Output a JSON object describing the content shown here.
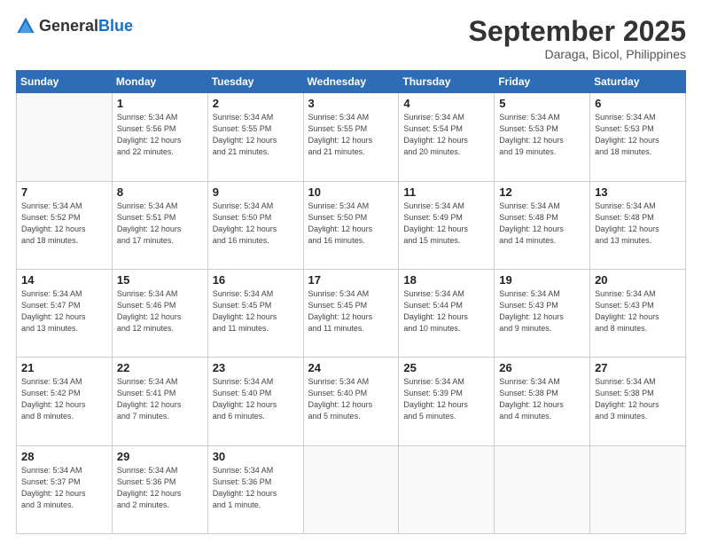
{
  "header": {
    "logo_general": "General",
    "logo_blue": "Blue",
    "month_title": "September 2025",
    "location": "Daraga, Bicol, Philippines"
  },
  "weekdays": [
    "Sunday",
    "Monday",
    "Tuesday",
    "Wednesday",
    "Thursday",
    "Friday",
    "Saturday"
  ],
  "weeks": [
    [
      {
        "day": "",
        "info": ""
      },
      {
        "day": "1",
        "info": "Sunrise: 5:34 AM\nSunset: 5:56 PM\nDaylight: 12 hours\nand 22 minutes."
      },
      {
        "day": "2",
        "info": "Sunrise: 5:34 AM\nSunset: 5:55 PM\nDaylight: 12 hours\nand 21 minutes."
      },
      {
        "day": "3",
        "info": "Sunrise: 5:34 AM\nSunset: 5:55 PM\nDaylight: 12 hours\nand 21 minutes."
      },
      {
        "day": "4",
        "info": "Sunrise: 5:34 AM\nSunset: 5:54 PM\nDaylight: 12 hours\nand 20 minutes."
      },
      {
        "day": "5",
        "info": "Sunrise: 5:34 AM\nSunset: 5:53 PM\nDaylight: 12 hours\nand 19 minutes."
      },
      {
        "day": "6",
        "info": "Sunrise: 5:34 AM\nSunset: 5:53 PM\nDaylight: 12 hours\nand 18 minutes."
      }
    ],
    [
      {
        "day": "7",
        "info": "Sunrise: 5:34 AM\nSunset: 5:52 PM\nDaylight: 12 hours\nand 18 minutes."
      },
      {
        "day": "8",
        "info": "Sunrise: 5:34 AM\nSunset: 5:51 PM\nDaylight: 12 hours\nand 17 minutes."
      },
      {
        "day": "9",
        "info": "Sunrise: 5:34 AM\nSunset: 5:50 PM\nDaylight: 12 hours\nand 16 minutes."
      },
      {
        "day": "10",
        "info": "Sunrise: 5:34 AM\nSunset: 5:50 PM\nDaylight: 12 hours\nand 16 minutes."
      },
      {
        "day": "11",
        "info": "Sunrise: 5:34 AM\nSunset: 5:49 PM\nDaylight: 12 hours\nand 15 minutes."
      },
      {
        "day": "12",
        "info": "Sunrise: 5:34 AM\nSunset: 5:48 PM\nDaylight: 12 hours\nand 14 minutes."
      },
      {
        "day": "13",
        "info": "Sunrise: 5:34 AM\nSunset: 5:48 PM\nDaylight: 12 hours\nand 13 minutes."
      }
    ],
    [
      {
        "day": "14",
        "info": "Sunrise: 5:34 AM\nSunset: 5:47 PM\nDaylight: 12 hours\nand 13 minutes."
      },
      {
        "day": "15",
        "info": "Sunrise: 5:34 AM\nSunset: 5:46 PM\nDaylight: 12 hours\nand 12 minutes."
      },
      {
        "day": "16",
        "info": "Sunrise: 5:34 AM\nSunset: 5:45 PM\nDaylight: 12 hours\nand 11 minutes."
      },
      {
        "day": "17",
        "info": "Sunrise: 5:34 AM\nSunset: 5:45 PM\nDaylight: 12 hours\nand 11 minutes."
      },
      {
        "day": "18",
        "info": "Sunrise: 5:34 AM\nSunset: 5:44 PM\nDaylight: 12 hours\nand 10 minutes."
      },
      {
        "day": "19",
        "info": "Sunrise: 5:34 AM\nSunset: 5:43 PM\nDaylight: 12 hours\nand 9 minutes."
      },
      {
        "day": "20",
        "info": "Sunrise: 5:34 AM\nSunset: 5:43 PM\nDaylight: 12 hours\nand 8 minutes."
      }
    ],
    [
      {
        "day": "21",
        "info": "Sunrise: 5:34 AM\nSunset: 5:42 PM\nDaylight: 12 hours\nand 8 minutes."
      },
      {
        "day": "22",
        "info": "Sunrise: 5:34 AM\nSunset: 5:41 PM\nDaylight: 12 hours\nand 7 minutes."
      },
      {
        "day": "23",
        "info": "Sunrise: 5:34 AM\nSunset: 5:40 PM\nDaylight: 12 hours\nand 6 minutes."
      },
      {
        "day": "24",
        "info": "Sunrise: 5:34 AM\nSunset: 5:40 PM\nDaylight: 12 hours\nand 5 minutes."
      },
      {
        "day": "25",
        "info": "Sunrise: 5:34 AM\nSunset: 5:39 PM\nDaylight: 12 hours\nand 5 minutes."
      },
      {
        "day": "26",
        "info": "Sunrise: 5:34 AM\nSunset: 5:38 PM\nDaylight: 12 hours\nand 4 minutes."
      },
      {
        "day": "27",
        "info": "Sunrise: 5:34 AM\nSunset: 5:38 PM\nDaylight: 12 hours\nand 3 minutes."
      }
    ],
    [
      {
        "day": "28",
        "info": "Sunrise: 5:34 AM\nSunset: 5:37 PM\nDaylight: 12 hours\nand 3 minutes."
      },
      {
        "day": "29",
        "info": "Sunrise: 5:34 AM\nSunset: 5:36 PM\nDaylight: 12 hours\nand 2 minutes."
      },
      {
        "day": "30",
        "info": "Sunrise: 5:34 AM\nSunset: 5:36 PM\nDaylight: 12 hours\nand 1 minute."
      },
      {
        "day": "",
        "info": ""
      },
      {
        "day": "",
        "info": ""
      },
      {
        "day": "",
        "info": ""
      },
      {
        "day": "",
        "info": ""
      }
    ]
  ]
}
